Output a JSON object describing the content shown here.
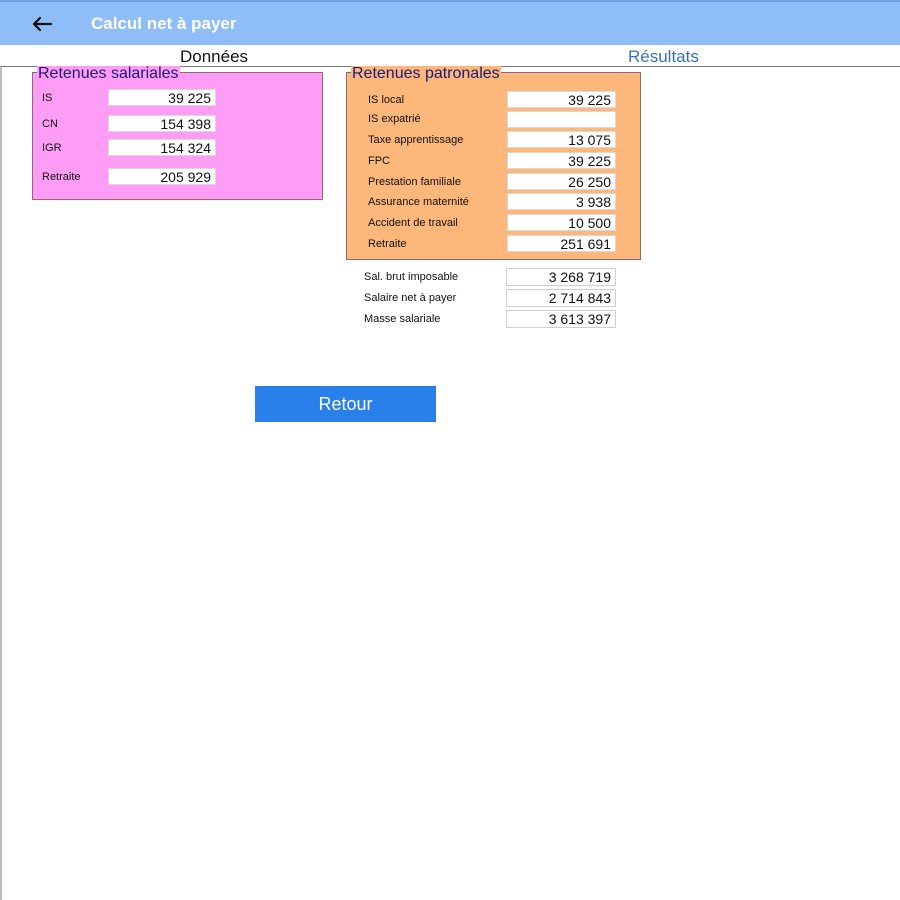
{
  "appbar": {
    "title": "Calcul net à payer",
    "back_icon": "arrow-left-icon"
  },
  "tabs": {
    "donnees": "Données",
    "resultats": "Résultats"
  },
  "salariales": {
    "legend": "Retenues salariales",
    "rows": [
      {
        "label": "IS",
        "value": "39 225"
      },
      {
        "label": "CN",
        "value": "154 398"
      },
      {
        "label": "IGR",
        "value": "154 324"
      },
      {
        "label": "Retraite",
        "value": "205 929"
      }
    ]
  },
  "patronales": {
    "legend": "Retenues patronales",
    "rows": [
      {
        "label": "IS local",
        "value": "39 225"
      },
      {
        "label": "IS expatrié",
        "value": ""
      },
      {
        "label": "Taxe apprentissage",
        "value": "13 075"
      },
      {
        "label": "FPC",
        "value": "39 225"
      },
      {
        "label": "Prestation familiale",
        "value": "26 250"
      },
      {
        "label": "Assurance maternité",
        "value": "3 938"
      },
      {
        "label": "Accident de travail",
        "value": "10 500"
      },
      {
        "label": "Retraite",
        "value": "251 691"
      }
    ]
  },
  "totals": [
    {
      "label": "Sal. brut imposable",
      "value": "3 268 719"
    },
    {
      "label": "Salaire net à payer",
      "value": "2 714 843"
    },
    {
      "label": "Masse salariale",
      "value": "3 613 397"
    }
  ],
  "retour_label": "Retour",
  "colors": {
    "appbar": "#8ebdf8",
    "salariales_bg": "#ff9cf6",
    "patronales_bg": "#fdb77a",
    "retour_bg": "#2a80ea",
    "tab_active": "#3a6fb8"
  }
}
